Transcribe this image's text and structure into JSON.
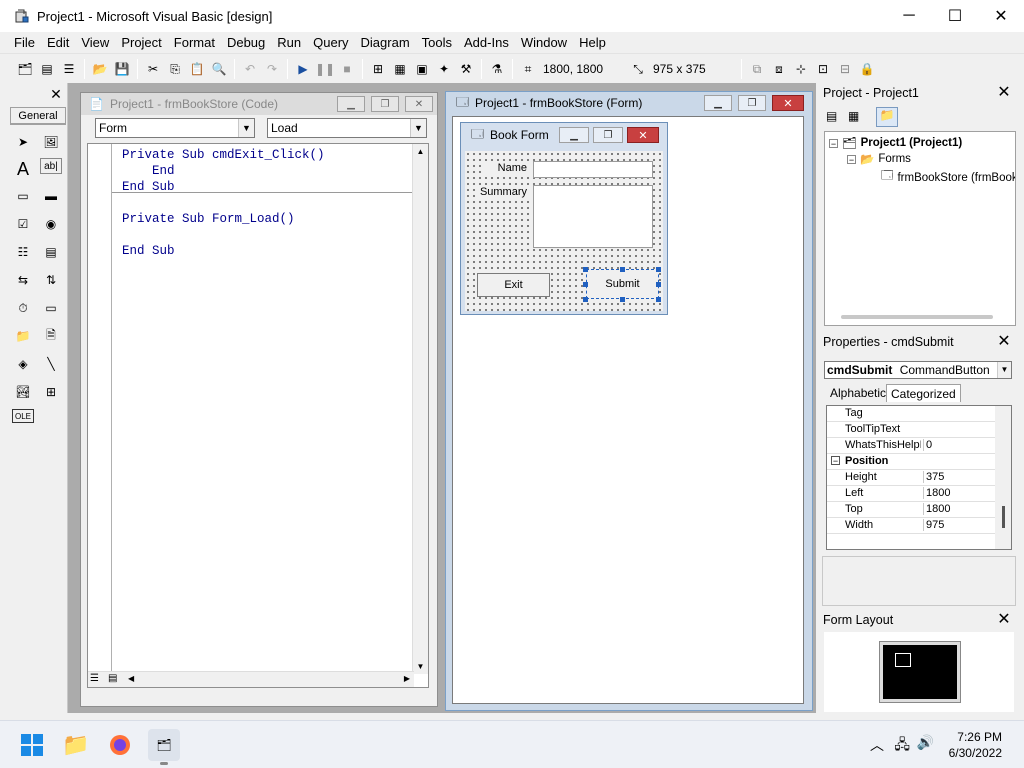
{
  "window": {
    "title": "Project1 - Microsoft Visual Basic [design]",
    "minimize": "─",
    "maximize": "☐",
    "close": "✕"
  },
  "menu": [
    "File",
    "Edit",
    "View",
    "Project",
    "Format",
    "Debug",
    "Run",
    "Query",
    "Diagram",
    "Tools",
    "Add-Ins",
    "Window",
    "Help"
  ],
  "toolbar": {
    "position": "1800, 1800",
    "size": "975 x 375"
  },
  "toolbox": {
    "tab_label": "General",
    "close": "✕"
  },
  "code_window": {
    "title": "Project1 - frmBookStore (Code)",
    "object_combo": "Form",
    "proc_combo": "Load",
    "lines": [
      "Private Sub cmdExit_Click()",
      "    End",
      "End Sub",
      "",
      "Private Sub Form_Load()",
      "",
      "End Sub"
    ]
  },
  "form_window": {
    "title": "Project1 - frmBookStore (Form)"
  },
  "book_form": {
    "title": "Book Form",
    "name_label": "Name",
    "summary_label": "Summary",
    "exit_button": "Exit",
    "submit_button": "Submit"
  },
  "project_panel": {
    "title": "Project - Project1",
    "root": "Project1 (Project1)",
    "folder": "Forms",
    "form": "frmBookStore (frmBookStore)",
    "close": "✕"
  },
  "properties_panel": {
    "title": "Properties - cmdSubmit",
    "object_name": "cmdSubmit",
    "object_type": "CommandButton",
    "tab_alphabetic": "Alphabetic",
    "tab_categorized": "Categorized",
    "close": "✕",
    "rows": [
      {
        "name": "Tag",
        "value": ""
      },
      {
        "name": "ToolTipText",
        "value": ""
      },
      {
        "name": "WhatsThisHelpID",
        "value": "0"
      },
      {
        "name": "Position",
        "value": "",
        "category": true
      },
      {
        "name": "Height",
        "value": "375"
      },
      {
        "name": "Left",
        "value": "1800"
      },
      {
        "name": "Top",
        "value": "1800"
      },
      {
        "name": "Width",
        "value": "975"
      }
    ]
  },
  "form_layout_panel": {
    "title": "Form Layout",
    "close": "✕"
  },
  "taskbar": {
    "time": "7:26 PM",
    "date": "6/30/2022"
  }
}
